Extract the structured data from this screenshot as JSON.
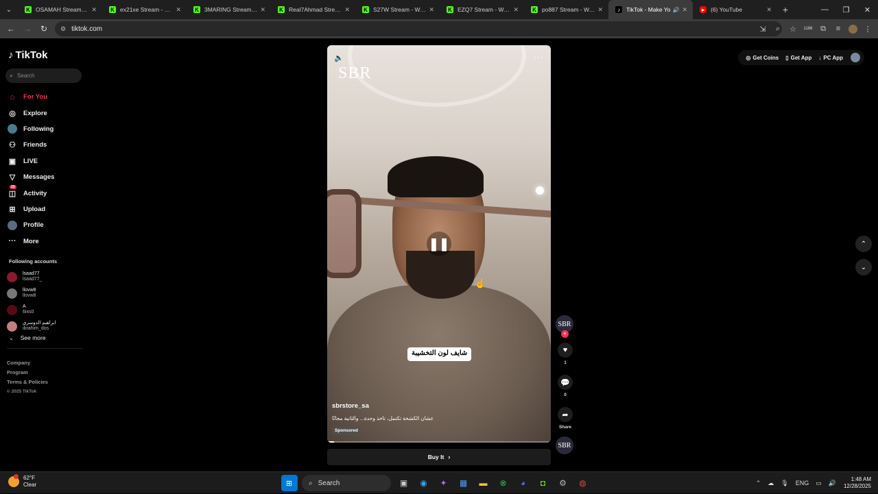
{
  "browser": {
    "tabs": [
      {
        "title": "OSAMAH Stream - W",
        "favicon": "kick"
      },
      {
        "title": "ex21xe Stream - Wat",
        "favicon": "kick"
      },
      {
        "title": "3MARING Stream - W",
        "favicon": "kick"
      },
      {
        "title": "Real7Ahmad Stream",
        "favicon": "kick"
      },
      {
        "title": "S27W Stream - Watc",
        "favicon": "kick"
      },
      {
        "title": "EZQ7 Stream - Watch",
        "favicon": "kick"
      },
      {
        "title": "po887 Stream - Watc",
        "favicon": "kick"
      },
      {
        "title": "TikTok - Make Yo",
        "favicon": "tiktok",
        "active": true
      },
      {
        "title": "(6) YouTube",
        "favicon": "youtube"
      }
    ],
    "url": "tiktok.com",
    "extension_badge": "1186"
  },
  "sidebar": {
    "logo": "TikTok",
    "search_placeholder": "Search",
    "nav": [
      {
        "label": "For You",
        "icon": "home-icon",
        "active": true
      },
      {
        "label": "Explore",
        "icon": "compass-icon"
      },
      {
        "label": "Following",
        "icon": "following-avatar-icon"
      },
      {
        "label": "Friends",
        "icon": "friends-icon"
      },
      {
        "label": "LIVE",
        "icon": "live-icon"
      },
      {
        "label": "Messages",
        "icon": "messages-icon"
      },
      {
        "label": "Activity",
        "icon": "activity-icon",
        "badge": "23"
      },
      {
        "label": "Upload",
        "icon": "upload-icon"
      },
      {
        "label": "Profile",
        "icon": "profile-avatar-icon"
      },
      {
        "label": "More",
        "icon": "more-icon"
      }
    ],
    "following_heading": "Following accounts",
    "accounts": [
      {
        "name": "lsaad77",
        "handle": "lsaad77_",
        "color": "#8b1a2a"
      },
      {
        "name": "llovw8",
        "handle": "llovw8",
        "color": "#777777"
      },
      {
        "name": "A",
        "handle": "6ixs0",
        "color": "#5a0a14"
      },
      {
        "name": "ابراهيم الدوسري",
        "handle": "ibrahim_dos",
        "color": "#c08080"
      }
    ],
    "see_more": "See more",
    "footer": [
      "Company",
      "Program",
      "Terms & Policies"
    ],
    "copyright": "© 2025 TikTok"
  },
  "topbar": {
    "get_coins": "Get Coins",
    "get_app": "Get App",
    "pc_app": "PC App"
  },
  "video": {
    "brand_overlay": "SBR",
    "caption": "شايف لون التخشيبة",
    "username": "sbrstore_sa",
    "description": "عشان الكشخة تكتمل، تاخذ وحدة... والثانية مجانًا",
    "sponsored": "Sponsored",
    "progress": 0.03,
    "buy_label": "Buy It"
  },
  "actions": {
    "avatar_text": "SBR",
    "likes": "1",
    "comments": "0",
    "share_label": "Share"
  },
  "taskbar": {
    "temp": "62°F",
    "condition": "Clear",
    "search_label": "Search",
    "lang": "ENG",
    "time": "1:48 AM",
    "date": "12/28/2025"
  }
}
